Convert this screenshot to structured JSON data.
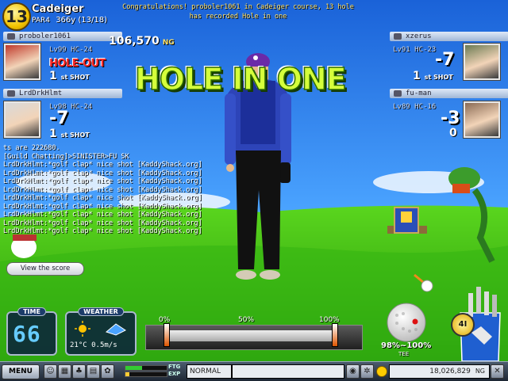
{
  "hole": {
    "number": "13",
    "course": "Cadeiger",
    "par": "PAR4",
    "distance": "366y",
    "progress": "(13/18)"
  },
  "system_message": "Congratulations! proboler1061 in Cadeiger course,  13 hole has recorded Hole in one",
  "banner": "HOLE IN ONE",
  "ng_money": {
    "value": "106,570",
    "unit": "NG"
  },
  "players": [
    {
      "name": "proboler1061",
      "level": "Lv99",
      "hc": "HC-24",
      "status": "HOLE-OUT",
      "score": "",
      "shot": "1",
      "shot_unit": "st SHOT",
      "portrait_color": "#c0392b"
    },
    {
      "name": "LrdDrkHlmt",
      "level": "Lv98",
      "hc": "HC-24",
      "score": "-7",
      "shot": "1",
      "shot_unit": "st SHOT",
      "portrait_color": "#d9d9d9"
    },
    {
      "name": "xzerus",
      "level": "Lv91",
      "hc": "HC-23",
      "score": "-7",
      "shot": "1",
      "shot_unit": "st SHOT",
      "portrait_color": "#6a7a52"
    },
    {
      "name": "fu-man",
      "level": "Lv89",
      "hc": "HC-16",
      "score": "-3",
      "shot": "0",
      "shot_unit": "",
      "portrait_color": "#8a6b55"
    }
  ],
  "chat": {
    "lines": [
      "ts are 222680.",
      "[Guild Chatting]>SINISTER>FU SK",
      "LrdDrkHlmt:*golf clap* nice shot [KaddyShack.org]",
      "LrdDrkHlmt:*golf clap* nice shot [KaddyShack.org]",
      "LrdDrkHlmt:*golf clap* nice shot [KaddyShack.org]",
      "LrdDrkHlmt:*golf clap* nice shot [KaddyShack.org]",
      "LrdDrkHlmt:*golf clap* nice shot [KaddyShack.org]",
      "LrdDrkHlmt:*golf clap* nice shot [KaddyShack.org]",
      "LrdDrkHlmt:*golf clap* nice shot [KaddyShack.org]",
      "LrdDrkHlmt:*golf clap* nice shot [KaddyShack.org]",
      "LrdDrkHlmt:*golf clap* nice shot [KaddyShack.org]"
    ]
  },
  "view_score_label": "View the score",
  "time": {
    "title": "TIME",
    "value": "66"
  },
  "weather": {
    "title": "WEATHER",
    "temperature": "21°C",
    "wind": "0.5m/s"
  },
  "gauge": {
    "label_0": "0%",
    "label_50": "50%",
    "label_100": "100%",
    "marker_start": 0.02,
    "marker_end": 0.98
  },
  "power": {
    "range": "98%~100%",
    "tee": "TEE"
  },
  "club_badge": "4I",
  "bottom_bar": {
    "menu": "MENU",
    "ftg": "FTG",
    "exp": "EXP",
    "mode": "NORMAL",
    "money": "18,026,829",
    "money_unit": "NG"
  },
  "colors": {
    "sky_top": "#1d6fe0",
    "sky_bottom": "#8fd0ff",
    "grass": "#2faa10",
    "banner_green": "#d5ff3b",
    "hole_out_red": "#ff2a2a"
  }
}
